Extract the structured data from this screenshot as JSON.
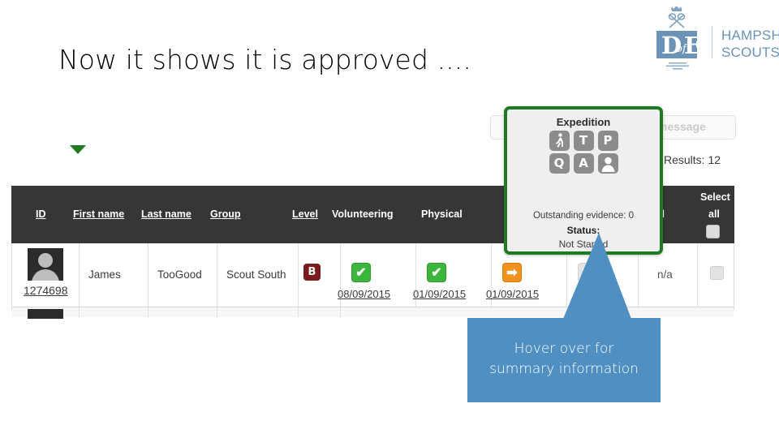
{
  "slide": {
    "title": "Now it shows it is approved ...."
  },
  "logo": {
    "brand_mark": "dofe-logo",
    "line1": "HAMPSHIRE",
    "line2": "SCOUTS",
    "color": "#6b93b5"
  },
  "app": {
    "toolbar": {
      "send_message_label": "message",
      "results_label": "Results:  12"
    },
    "table": {
      "headers": [
        {
          "label": "ID",
          "sortable": false
        },
        {
          "label": "First name",
          "sortable": true
        },
        {
          "label": "Last name",
          "sortable": true
        },
        {
          "label": "Group",
          "sortable": true
        },
        {
          "label": "Level",
          "sortable": true
        },
        {
          "label": "Volunteering",
          "sortable": false
        },
        {
          "label": "Physical",
          "sortable": false
        },
        {
          "label": "rtial",
          "sortable": false
        },
        {
          "label": "Select",
          "sortable": false
        },
        {
          "label": "all",
          "sortable": false
        }
      ],
      "rows": [
        {
          "id": "1274698",
          "first_name": "James",
          "last_name": "TooGood",
          "group": "Scout South",
          "level": "B",
          "level_color": "#7b1c1c",
          "volunteering": {
            "icon": "green-tick-icon",
            "glyph": "✔",
            "date": "08/09/2015"
          },
          "physical": {
            "icon": "green-tick-icon",
            "glyph": "✔",
            "date": "01/09/2015"
          },
          "skills": {
            "icon": "orange-arrow-icon",
            "glyph": "➡",
            "date": "01/09/2015"
          },
          "expedition": {
            "icon": "grey-cross-icon",
            "glyph": "✖",
            "date": ""
          },
          "residential": "n/a",
          "selected": false
        }
      ]
    }
  },
  "tooltip": {
    "title": "Expedition",
    "badges": [
      {
        "name": "walking-person-icon",
        "glyph": ""
      },
      {
        "name": "letter-t-icon",
        "glyph": "T"
      },
      {
        "name": "letter-p-icon",
        "glyph": "P"
      },
      {
        "name": "letter-q-icon",
        "glyph": "Q"
      },
      {
        "name": "letter-a-icon",
        "glyph": "A"
      },
      {
        "name": "person-silhouette-icon",
        "glyph": ""
      }
    ],
    "evidence_text": "Outstanding evidence: 0",
    "status_label": "Status:",
    "status_value": "Not Started",
    "border_color": "#1f7a23"
  },
  "callout": {
    "text_line1": "Hover over for",
    "text_line2": "summary information",
    "color": "#4f8fc2"
  }
}
